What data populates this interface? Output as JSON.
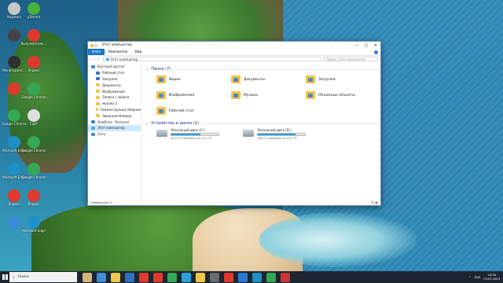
{
  "desktop": {
    "icons": [
      {
        "label": "Корзина",
        "color": "#c8c8c8"
      },
      {
        "label": "µTorrent",
        "color": "#46b33a"
      },
      {
        "label": "",
        "color": "#444"
      },
      {
        "label": "Выпрямитель...",
        "color": "#e03a2f"
      },
      {
        "label": "Мониторинг...",
        "color": "#2f2f2f"
      },
      {
        "label": "Яндекс",
        "color": "#e03a2f"
      },
      {
        "label": "",
        "color": "#e03a2f"
      },
      {
        "label": "Google Chrome",
        "color": "#34a853"
      },
      {
        "label": "Google Chrome",
        "color": "#34a853"
      },
      {
        "label": "Сайт",
        "color": "#ddd"
      },
      {
        "label": "Microsoft Edge",
        "color": "#1e90c8"
      },
      {
        "label": "Google Chrome",
        "color": "#34a853"
      },
      {
        "label": "Microsoft Edge",
        "color": "#1e90c8"
      },
      {
        "label": "Google Chrome",
        "color": "#34a853"
      },
      {
        "label": "Яндекс",
        "color": "#e03a2f"
      },
      {
        "label": "Яндекс",
        "color": "#e03a2f"
      },
      {
        "label": "",
        "color": "#3a8ad8"
      },
      {
        "label": "Microsoft Edge",
        "color": "#1e90c8"
      }
    ]
  },
  "window": {
    "title": "Этот компьютер",
    "controls": [
      "—",
      "□",
      "✕"
    ],
    "ribbon_tabs": [
      "Файл",
      "Компьютер",
      "Вид"
    ],
    "help": "?",
    "address": "Этот компьютер",
    "search_placeholder": "Поиск: Этот компьютер",
    "nav": [
      {
        "label": "Быстрый доступ",
        "icon": "star",
        "sub": false
      },
      {
        "label": "Рабочий стол",
        "icon": "blue",
        "sub": true
      },
      {
        "label": "Загрузки",
        "icon": "blue",
        "sub": true
      },
      {
        "label": "Документы",
        "icon": "folder",
        "sub": true
      },
      {
        "label": "Изображения",
        "icon": "folder",
        "sub": true
      },
      {
        "label": "Записи с экрана",
        "icon": "folder",
        "sub": true
      },
      {
        "label": "музыка 2",
        "icon": "folder",
        "sub": true
      },
      {
        "label": "Свежая музыка сборник",
        "icon": "folder",
        "sub": true
      },
      {
        "label": "Экранная Камера",
        "icon": "folder",
        "sub": true
      },
      {
        "label": "OneDrive - Personal",
        "icon": "od",
        "sub": false
      },
      {
        "label": "Этот компьютер",
        "icon": "pc",
        "sub": false,
        "selected": true
      },
      {
        "label": "Сеть",
        "icon": "net",
        "sub": false
      }
    ],
    "folders_group": "Папки (7)",
    "folders": [
      "Видео",
      "Документы",
      "Загрузки",
      "Изображения",
      "Музыка",
      "Объемные объекты",
      "Рабочий стол"
    ],
    "drives_group": "Устройства и диски (2)",
    "drives": [
      {
        "name": "Локальный диск (C:)",
        "size": "42,6 ГБ свободно из 111 ГБ",
        "used": 0.62
      },
      {
        "name": "Локальный диск (D:)",
        "size": "188 ГБ свободно из 931 ГБ",
        "used": 0.8
      }
    ],
    "status": "Элементов: 9",
    "view_icons": "☰ ▦"
  },
  "taskbar": {
    "search_placeholder": "Поиск",
    "apps": [
      "#d8b37a",
      "#3c8fd6",
      "#f0c64b",
      "#2f6fc0",
      "#e03a2f",
      "#e03a2f",
      "#34a853",
      "#2ea0d8",
      "#f0c64b",
      "#6b6b6b",
      "#e03a2f",
      "#2a78d4",
      "#1e90c8",
      "#34a853",
      "#cc3333"
    ],
    "lang": "ENG",
    "time": "16:56",
    "date": "03.01.2023"
  }
}
